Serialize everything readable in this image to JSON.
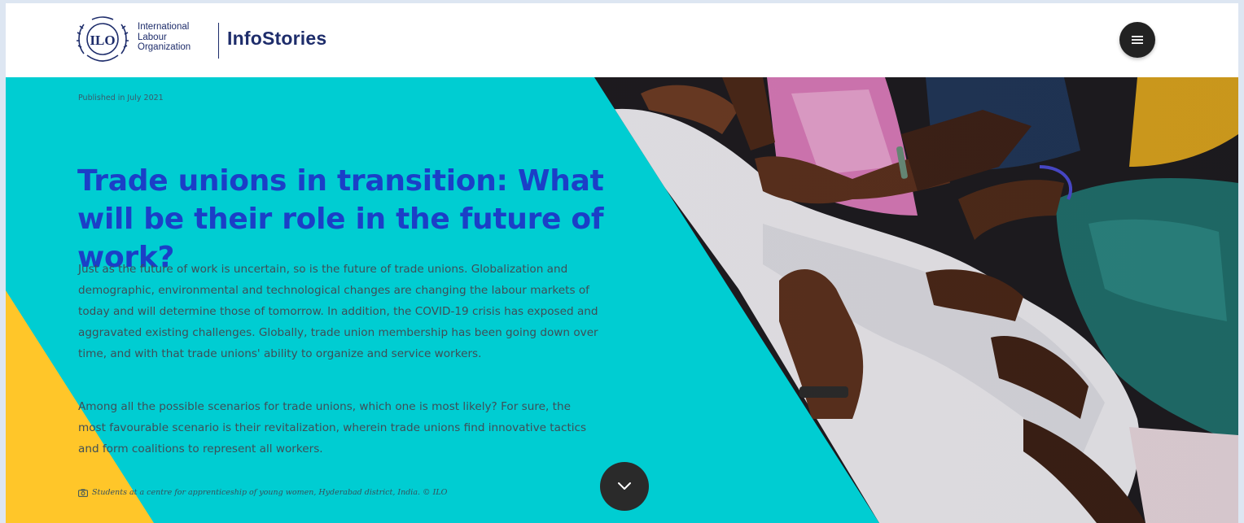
{
  "header": {
    "org_name_lines": [
      "International",
      "Labour",
      "Organization"
    ],
    "emblem_letters": "ILO",
    "brand": "InfoStories",
    "menu_icon": "hamburger-icon"
  },
  "hero": {
    "published": "Published in July 2021",
    "title": "Trade unions in transition: What will be their role in the future of work?",
    "paragraphs": [
      "Just as the future of work is uncertain, so is the future of trade unions. Globalization and demographic, environmental and technological changes are changing the labour markets of today and will determine those of tomorrow. In addition, the COVID-19 crisis has exposed and aggravated existing challenges. Globally, trade union membership has been going down over time, and with that trade unions' ability to organize and service workers.",
      "Among all the possible scenarios for trade unions, which one is most likely? For sure, the most favourable scenario is their revitalization, wherein trade unions find innovative tactics and form coalitions to represent all workers."
    ],
    "caption": "Students at a centre for apprenticeship of young women, Hyderabad district, India. © ILO",
    "caption_icon": "camera-icon",
    "scroll_icon": "chevron-down-icon"
  },
  "colors": {
    "teal": "#00cdd2",
    "yellow": "#ffc629",
    "title_blue": "#1b3fc7",
    "navy": "#1e2d6b"
  }
}
